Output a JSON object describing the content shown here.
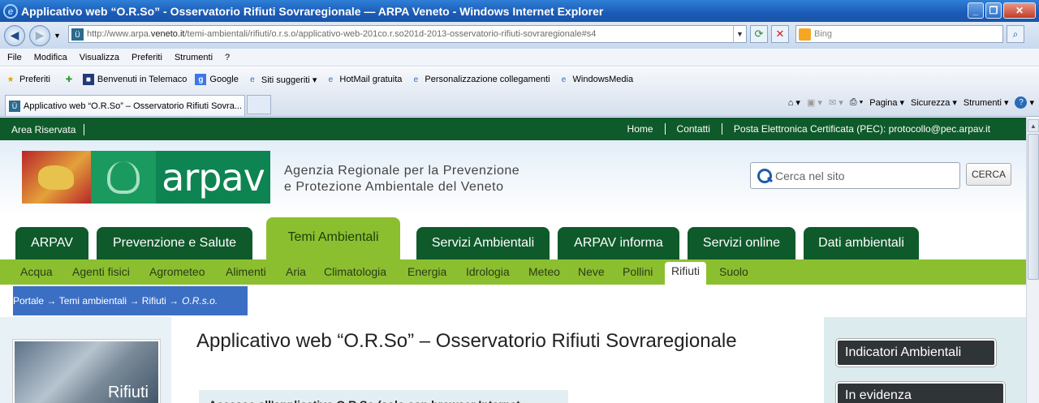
{
  "window": {
    "title": "Applicativo web “O.R.So” - Osservatorio Rifiuti Sovraregionale — ARPA Veneto - Windows Internet Explorer"
  },
  "addressbar": {
    "url_prefix": "http://www.arpa.",
    "url_domain": "veneto.it",
    "url_rest": "/temi-ambientali/rifiuti/o.r.s.o/applicativo-web-201co.r.so201d-2013-osservatorio-rifiuti-sovraregionale#s4",
    "search_placeholder": "Bing"
  },
  "menubar": [
    "File",
    "Modifica",
    "Visualizza",
    "Preferiti",
    "Strumenti",
    "?"
  ],
  "favorites": {
    "label": "Preferiti",
    "items": [
      "Benvenuti in Telemaco",
      "Google",
      "Siti suggeriti ▾",
      "HotMail gratuita",
      "Personalizzazione collegamenti",
      "WindowsMedia"
    ]
  },
  "tab": {
    "label": "Applicativo web “O.R.So” – Osservatorio Rifiuti Sovra..."
  },
  "commandbar": {
    "page": "Pagina",
    "security": "Sicurezza",
    "tools": "Strumenti"
  },
  "site": {
    "topbar": {
      "area": "Area Riservata",
      "links": [
        "Home",
        "Contatti",
        "Posta Elettronica Certificata (PEC): protocollo@pec.arpav.it"
      ]
    },
    "logo_text": "arpav",
    "agency_line1": "Agenzia Regionale per la Prevenzione",
    "agency_line2": "e Protezione Ambientale del Veneto",
    "search_placeholder": "Cerca nel sito",
    "search_button": "CERCA",
    "main_tabs": [
      "ARPAV",
      "Prevenzione e Salute",
      "Temi Ambientali",
      "Servizi Ambientali",
      "ARPAV informa",
      "Servizi online",
      "Dati ambientali"
    ],
    "sub_tabs": [
      "Acqua",
      "Agenti fisici",
      "Agrometeo",
      "Alimenti",
      "Aria",
      "Climatologia",
      "Energia",
      "Idrologia",
      "Meteo",
      "Neve",
      "Pollini",
      "Rifiuti",
      "Suolo"
    ],
    "breadcrumb": {
      "portale": "Portale",
      "temi": "Temi ambientali",
      "rifiuti": "Rifiuti",
      "current": "O.R.s.o.",
      "sep": "→"
    },
    "side_image_label": "Rifiuti",
    "page_title": "Applicativo web “O.R.So” – Osservatorio Rifiuti Sovraregionale",
    "note": "Accesso all'applicativo O.R.So (solo con browser Internet Explorer):",
    "right_buttons": [
      "Indicatori Ambientali",
      "In evidenza"
    ]
  }
}
